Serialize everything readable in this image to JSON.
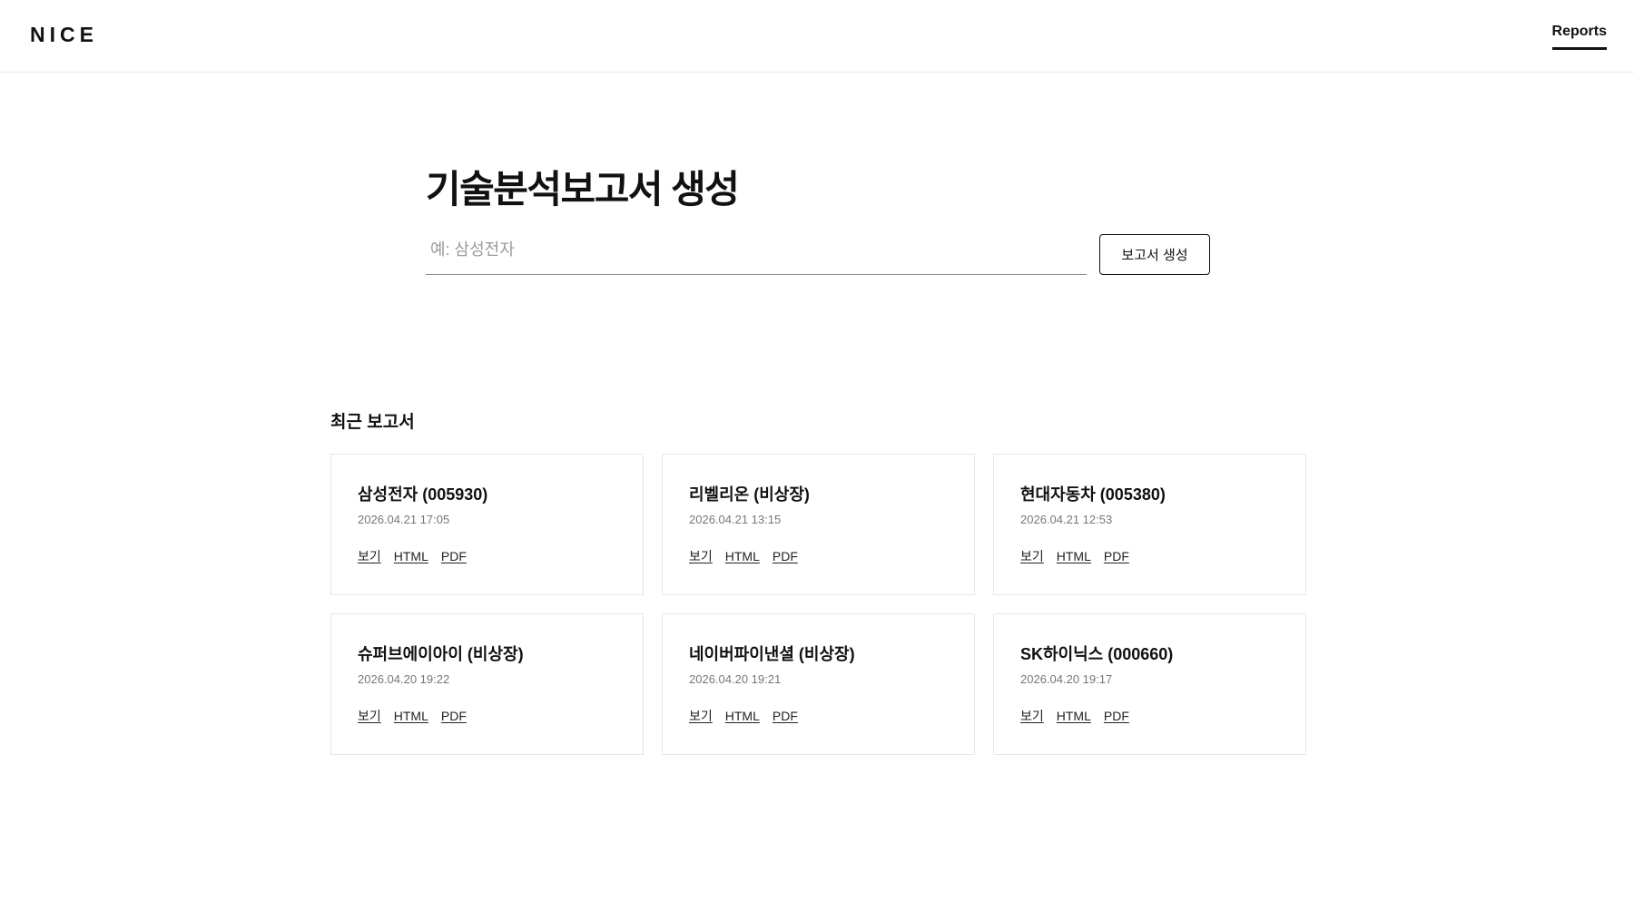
{
  "header": {
    "logo": "NICE",
    "nav_reports": "Reports"
  },
  "create": {
    "title": "기술분석보고서 생성",
    "input_placeholder": "예: 삼성전자",
    "input_value": "",
    "button_label": "보고서 생성"
  },
  "recent": {
    "title": "최근 보고서",
    "reports": [
      {
        "name": "삼성전자 (005930)",
        "date": "2026.04.21 17:05",
        "links": [
          "보기",
          "HTML",
          "PDF"
        ]
      },
      {
        "name": "리벨리온 (비상장)",
        "date": "2026.04.21 13:15",
        "links": [
          "보기",
          "HTML",
          "PDF"
        ]
      },
      {
        "name": "현대자동차 (005380)",
        "date": "2026.04.21 12:53",
        "links": [
          "보기",
          "HTML",
          "PDF"
        ]
      },
      {
        "name": "슈퍼브에이아이 (비상장)",
        "date": "2026.04.20 19:22",
        "links": [
          "보기",
          "HTML",
          "PDF"
        ]
      },
      {
        "name": "네이버파이낸셜 (비상장)",
        "date": "2026.04.20 19:21",
        "links": [
          "보기",
          "HTML",
          "PDF"
        ]
      },
      {
        "name": "SK하이닉스 (000660)",
        "date": "2026.04.20 19:17",
        "links": [
          "보기",
          "HTML",
          "PDF"
        ]
      }
    ]
  }
}
